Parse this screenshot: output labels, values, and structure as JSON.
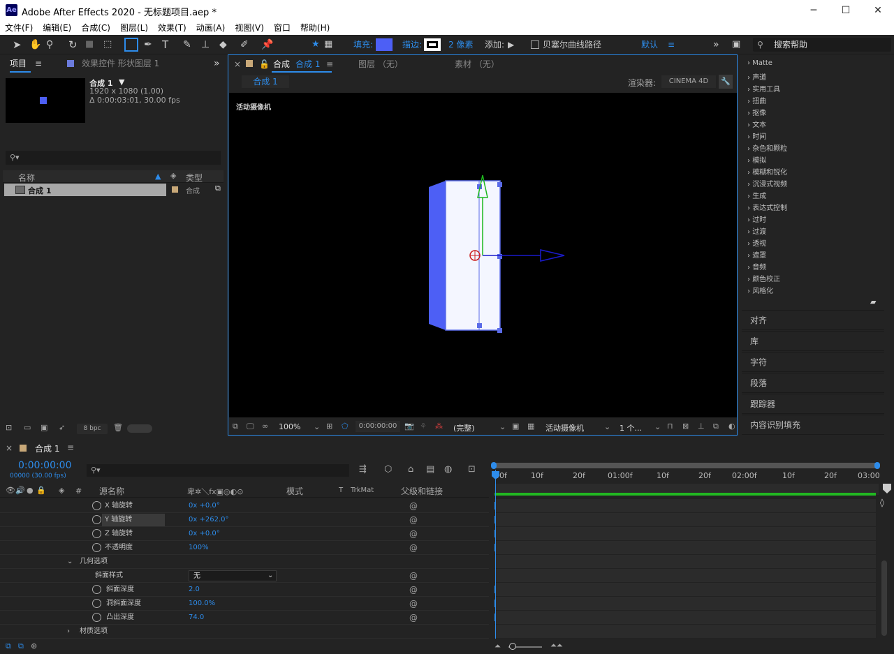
{
  "app": {
    "logo_text": "Ae",
    "title": "Adobe After Effects 2020 - 无标题项目.aep *"
  },
  "window_controls": {
    "minimize": "─",
    "maximize": "☐",
    "close": "✕"
  },
  "menu": [
    "文件(F)",
    "编辑(E)",
    "合成(C)",
    "图层(L)",
    "效果(T)",
    "动画(A)",
    "视图(V)",
    "窗口",
    "帮助(H)"
  ],
  "toolbar": {
    "fill_label": "填充:",
    "stroke_label": "描边:",
    "stroke_px": "2 像素",
    "add_label": "添加:",
    "bezier_label": "贝塞尔曲线路径",
    "workspace": "默认",
    "search_placeholder": "搜索帮助",
    "fill_color": "#4d5ff5",
    "accent": "#2d8ceb"
  },
  "project": {
    "tab_project": "项目",
    "tab_effects": "效果控件 形状图层 1",
    "comp_name": "合成 1",
    "comp_size": "1920 x 1080 (1.00)",
    "comp_duration": "Δ 0:00:03:01, 30.00 fps",
    "col_name": "名称",
    "col_type": "类型",
    "item_name": "合成 1",
    "item_type": "合成",
    "bpc": "8 bpc"
  },
  "viewer": {
    "tab_comp_prefix": "合成",
    "tab_comp_name": "合成 1",
    "tab_layer": "图层 （无）",
    "tab_footage": "素材 （无）",
    "subtab": "合成 1",
    "renderer_label": "渲染器:",
    "renderer": "CINEMA 4D",
    "camera_label": "活动摄像机",
    "zoom": "100%",
    "timecode": "0:00:00:00",
    "resolution": "(完整)",
    "view": "活动摄像机",
    "views": "1 个..."
  },
  "effects_list": [
    "Matte",
    "声道",
    "实用工具",
    "扭曲",
    "抠像",
    "文本",
    "时间",
    "杂色和颗粒",
    "模拟",
    "模糊和锐化",
    "沉浸式视频",
    "生成",
    "表达式控制",
    "过时",
    "过渡",
    "透视",
    "遮罩",
    "音频",
    "颜色校正",
    "风格化"
  ],
  "right_sections": [
    "对齐",
    "库",
    "字符",
    "段落",
    "跟踪器",
    "内容识别填充"
  ],
  "timeline": {
    "tab": "合成 1",
    "timecode": "0:00:00:00",
    "fps": "00000 (30.00 fps)",
    "col_source": "源名称",
    "col_mode": "模式",
    "col_t": "T",
    "col_trkmat": "TrkMat",
    "col_parent": "父级和链接",
    "ruler": [
      "00f",
      "10f",
      "20f",
      "01:00f",
      "10f",
      "20f",
      "02:00f",
      "10f",
      "20f",
      "03:00"
    ],
    "rows": [
      {
        "name": "X 轴旋转",
        "value": "0x +0.0°",
        "stopwatch": true,
        "pickwhip": true
      },
      {
        "name": "Y 轴旋转",
        "value": "0x +262.0°",
        "stopwatch": true,
        "pickwhip": true,
        "selected": true
      },
      {
        "name": "Z 轴旋转",
        "value": "0x +0.0°",
        "stopwatch": true,
        "pickwhip": true
      },
      {
        "name": "不透明度",
        "value": "100%",
        "stopwatch": true,
        "pickwhip": true
      },
      {
        "name": "几何选项",
        "value": "",
        "group": true
      },
      {
        "name": "斜面样式",
        "value": "无",
        "dropdown": true,
        "pickwhip": true
      },
      {
        "name": "斜面深度",
        "value": "2.0",
        "stopwatch": true,
        "pickwhip": true
      },
      {
        "name": "洞斜面深度",
        "value": "100.0%",
        "stopwatch": true,
        "pickwhip": true
      },
      {
        "name": "凸出深度",
        "value": "74.0",
        "stopwatch": true,
        "pickwhip": true
      },
      {
        "name": "材质选项",
        "value": "",
        "group": true,
        "collapsed": true
      }
    ]
  }
}
